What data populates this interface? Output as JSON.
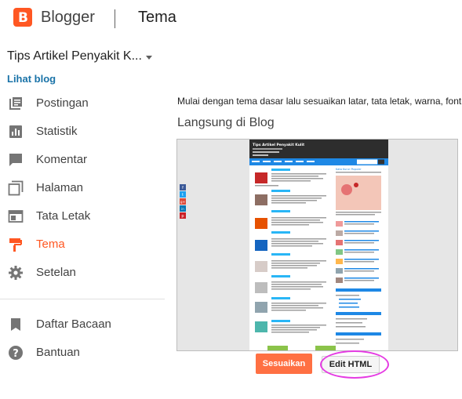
{
  "header": {
    "brand": "Blogger",
    "section": "Tema"
  },
  "sidebar": {
    "blog_name": "Tips Artikel Penyakit K...",
    "view_blog": "Lihat blog",
    "items": [
      {
        "label": "Postingan",
        "icon": "posts-icon"
      },
      {
        "label": "Statistik",
        "icon": "stats-icon"
      },
      {
        "label": "Komentar",
        "icon": "comments-icon"
      },
      {
        "label": "Halaman",
        "icon": "pages-icon"
      },
      {
        "label": "Tata Letak",
        "icon": "layout-icon"
      },
      {
        "label": "Tema",
        "icon": "theme-icon",
        "active": true
      },
      {
        "label": "Setelan",
        "icon": "settings-icon"
      },
      {
        "label": "Daftar Bacaan",
        "icon": "reading-list-icon"
      },
      {
        "label": "Bantuan",
        "icon": "help-icon"
      }
    ]
  },
  "main": {
    "intro": "Mulai dengan tema dasar lalu sesuaikan latar, tata letak, warna, font",
    "live_title": "Langsung di Blog",
    "preview": {
      "blog_title": "Tips Artikel Penyakit Kulit",
      "sidebar_heading": "Kata Kunci Populer",
      "social": [
        "f",
        "t",
        "g+",
        "in",
        "p"
      ]
    },
    "buttons": {
      "customize": "Sesuaikan",
      "edit_html": "Edit HTML"
    }
  },
  "colors": {
    "accent": "#ff5722",
    "link": "#1a73a8",
    "highlight": "#e53be3"
  }
}
